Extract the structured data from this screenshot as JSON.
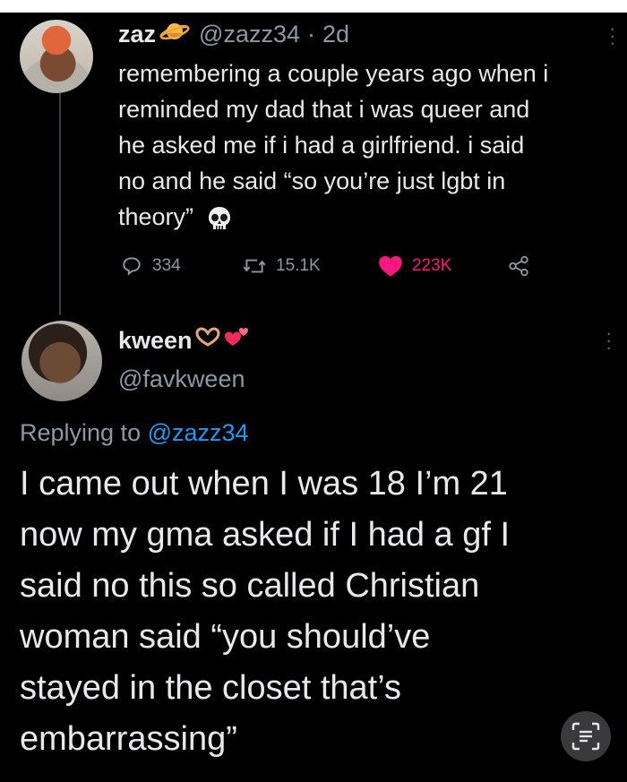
{
  "tweet1": {
    "display_name": "zaz",
    "handle": "@zazz34",
    "separator": "·",
    "time": "2d",
    "lines": [
      "remembering a couple years ago when i",
      "reminded my dad that i was queer and",
      "he asked me if i had a girlfriend. i said",
      "no and he said “so you’re just lgbt in",
      "theory”"
    ],
    "name_emoji": "planet-emoji",
    "text_emoji": "skull-emoji",
    "stats": {
      "replies": "334",
      "retweets": "15.1K",
      "likes": "223K"
    }
  },
  "tweet2": {
    "display_name": "kween",
    "handle": "@favkween",
    "name_emojis": [
      "heart-hands-emoji",
      "revolving-hearts-emoji"
    ],
    "replying_prefix": "Replying to",
    "replying_handle": "@zazz34",
    "lines": [
      "I came out when I was 18 I’m 21",
      "now my gma asked if I had a gf I",
      "said no this so called Christian",
      "woman said “you should’ve",
      "stayed in the closet that’s",
      "embarrassing”"
    ]
  },
  "colors": {
    "background": "#000000",
    "text": "#e7e9ea",
    "muted": "#8b98a5",
    "like": "#f91880",
    "mention": "#1d9bf0"
  },
  "icons": {
    "reply": "reply-icon",
    "retweet": "retweet-icon",
    "like": "heart-icon",
    "share": "share-icon",
    "scan": "text-scan-icon",
    "menu": "more-icon"
  }
}
